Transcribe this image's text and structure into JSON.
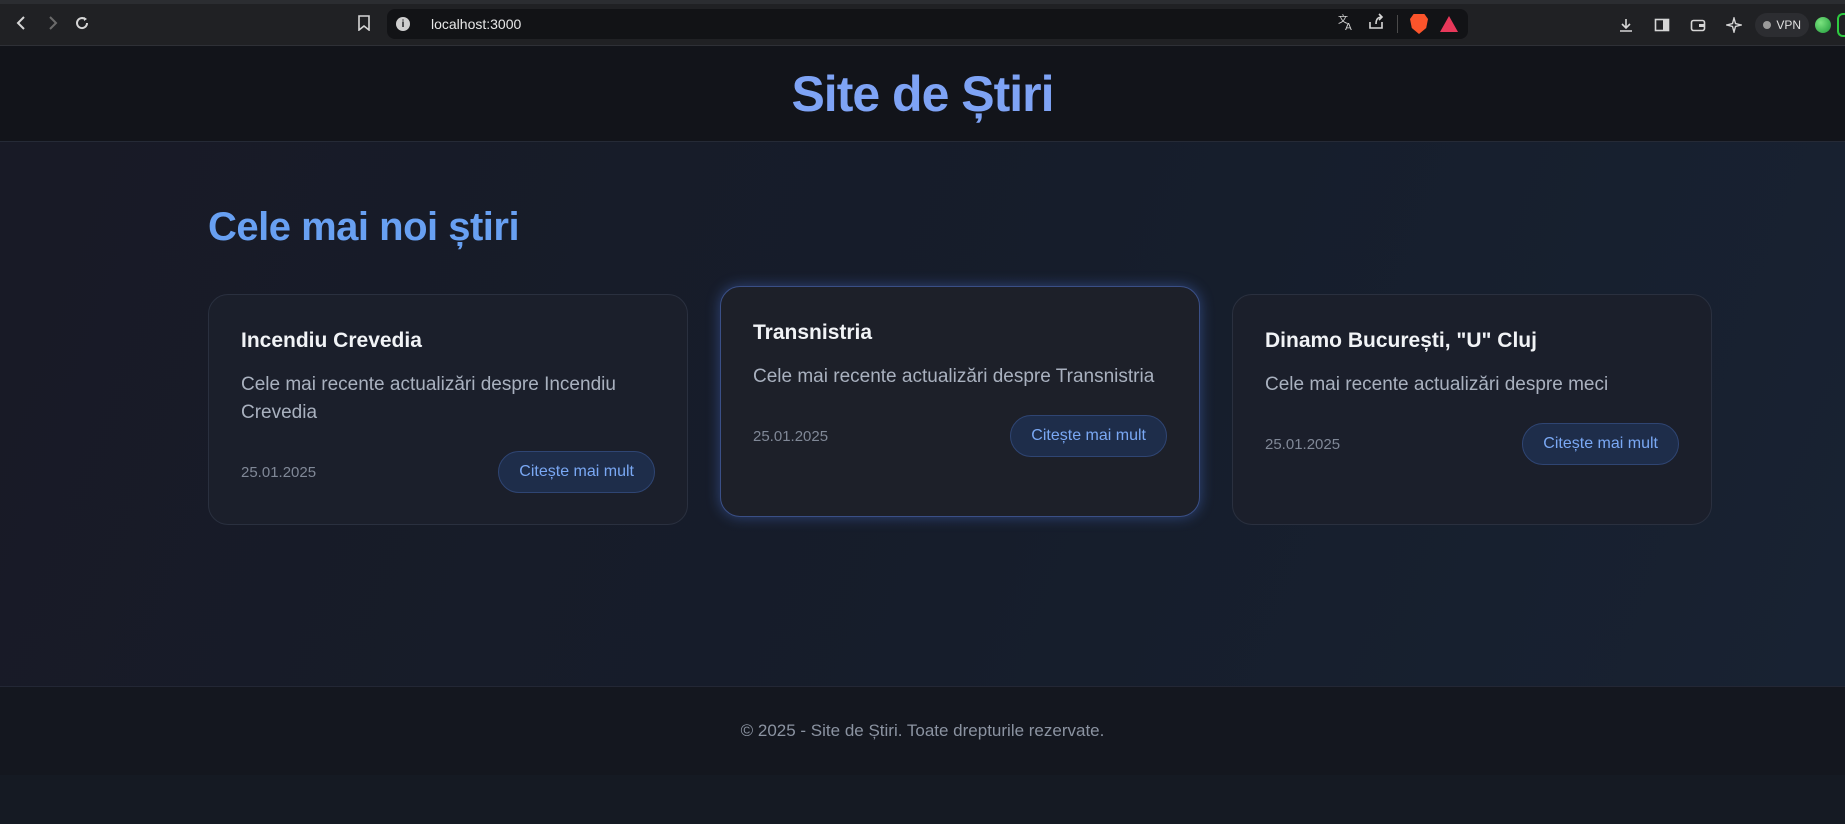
{
  "browser": {
    "url": "localhost:3000",
    "vpn_label": "VPN",
    "icons": [
      "back-icon",
      "forward-icon",
      "reload-icon",
      "bookmark-icon",
      "site-info-icon",
      "translate-icon",
      "share-icon",
      "brave-shields-icon",
      "brave-rewards-icon",
      "download-icon",
      "sidebar-icon",
      "wallet-icon",
      "leo-ai-icon",
      "profile-icon"
    ]
  },
  "site": {
    "title": "Site de Știri"
  },
  "main": {
    "section_title": "Cele mai noi știri",
    "cards": [
      {
        "title": "Incendiu Crevedia",
        "description": "Cele mai recente actualizări despre Incendiu Crevedia",
        "date": "25.01.2025",
        "button": "Citește mai mult"
      },
      {
        "title": "Transnistria",
        "description": "Cele mai recente actualizări despre Transnistria",
        "date": "25.01.2025",
        "button": "Citește mai mult"
      },
      {
        "title": "Dinamo București, \"U\" Cluj",
        "description": "Cele mai recente actualizări despre meci",
        "date": "25.01.2025",
        "button": "Citește mai mult"
      }
    ]
  },
  "footer": {
    "text": "© 2025 - Site de Știri. Toate drepturile rezervate."
  },
  "colors": {
    "accent": "#68a0f2",
    "title": "#7ea3f5",
    "background": "#171b27"
  }
}
